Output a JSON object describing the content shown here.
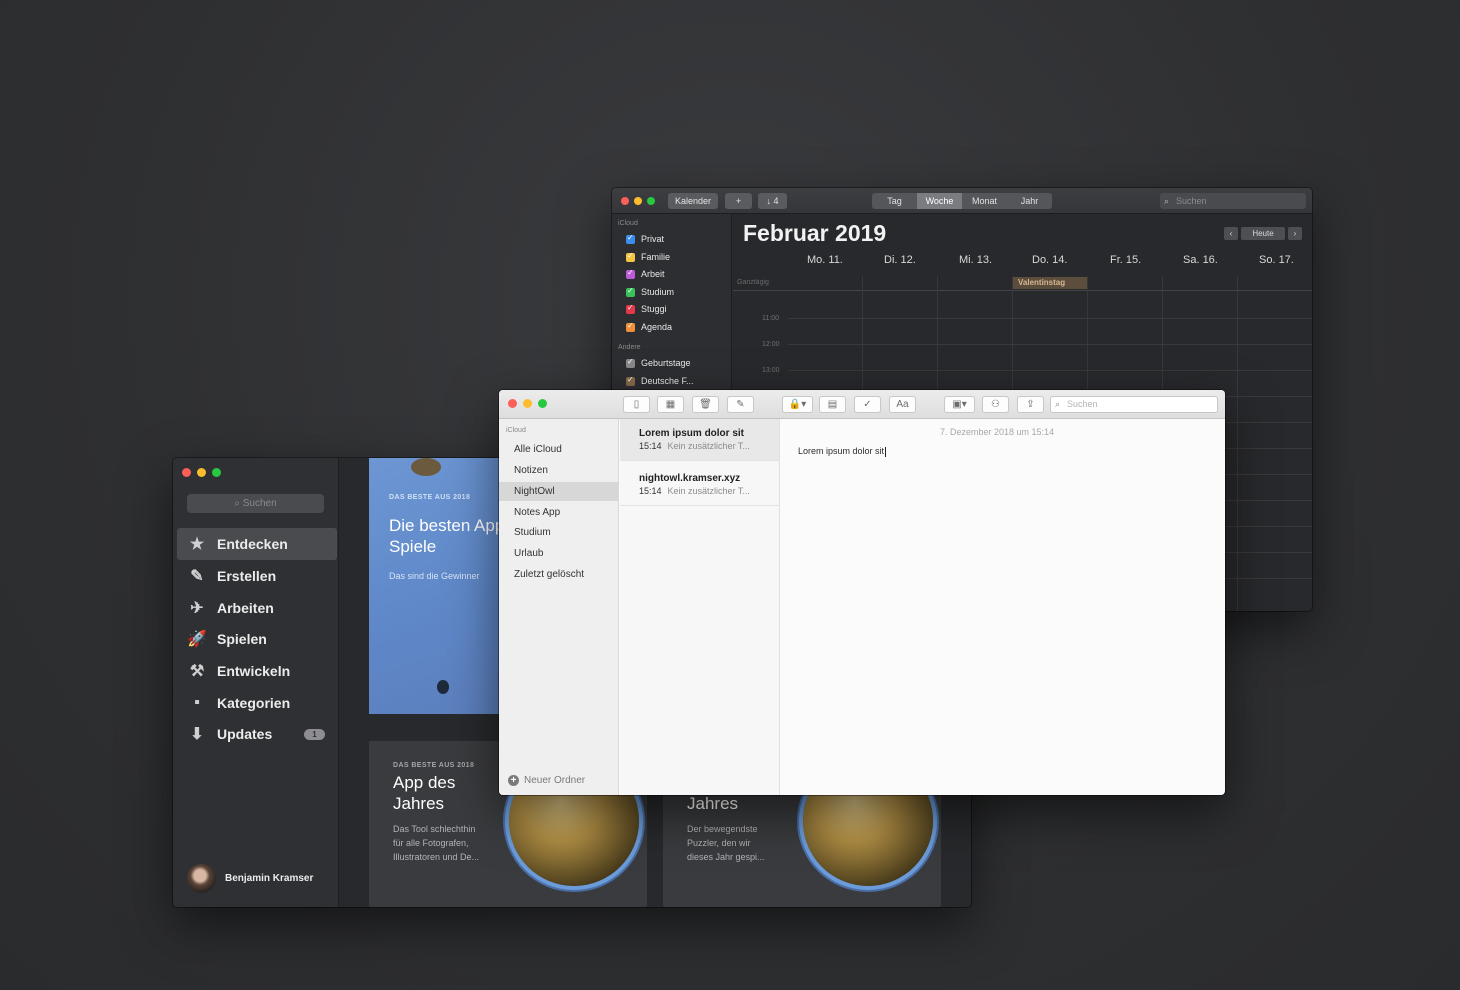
{
  "calendar": {
    "toolbar": {
      "calendars_button": "Kalender",
      "add_button": "+",
      "inbox_button": "↓ 4",
      "views": [
        "Tag",
        "Woche",
        "Monat",
        "Jahr"
      ],
      "active_view": "Woche",
      "search_placeholder": "Suchen"
    },
    "sidebar": {
      "section_icloud": "iCloud",
      "icloud_items": [
        {
          "label": "Privat",
          "color": "#3b8ef0"
        },
        {
          "label": "Familie",
          "color": "#f6c443"
        },
        {
          "label": "Arbeit",
          "color": "#bb5bd8"
        },
        {
          "label": "Studium",
          "color": "#39c15a"
        },
        {
          "label": "Stuggi",
          "color": "#e3394a"
        },
        {
          "label": "Agenda",
          "color": "#f0903a"
        }
      ],
      "section_other": "Andere",
      "other_items": [
        {
          "label": "Geburtstage",
          "color": "#8a8a8c"
        },
        {
          "label": "Deutsche F...",
          "color": "#8a6a4a"
        }
      ]
    },
    "title": "Februar 2019",
    "today_button": "Heute",
    "prev_icon": "‹",
    "next_icon": "›",
    "days": [
      "Mo. 11.",
      "Di. 12.",
      "Mi. 13.",
      "Do. 14.",
      "Fr. 15.",
      "Sa. 16.",
      "So. 17."
    ],
    "allday_label": "Ganztägig",
    "allday_event": "Valentinstag",
    "times": [
      "11:00",
      "12:00",
      "13:00"
    ]
  },
  "appstore": {
    "search_placeholder": "Suchen",
    "nav": [
      {
        "label": "Entdecken",
        "icon": "★"
      },
      {
        "label": "Erstellen",
        "icon": "✎"
      },
      {
        "label": "Arbeiten",
        "icon": "✈"
      },
      {
        "label": "Spielen",
        "icon": "🚀"
      },
      {
        "label": "Entwickeln",
        "icon": "⚒"
      },
      {
        "label": "Kategorien",
        "icon": "▪"
      },
      {
        "label": "Updates",
        "icon": "⬇"
      }
    ],
    "updates_badge": "1",
    "user_name": "Benjamin Kramser",
    "card1": {
      "eyebrow": "DAS BESTE AUS 2018",
      "title": "Die besten Apps und Spiele",
      "subtitle": "Das sind die Gewinner"
    },
    "card2": {
      "eyebrow": "DAS BESTE AUS 2018",
      "title_line1": "App des",
      "title_line2": "Jahres",
      "desc_line1": "Das Tool schlechthin",
      "desc_line2": "für alle Fotografen,",
      "desc_line3": "Illustratoren und De..."
    },
    "card3": {
      "title_line2": "Jahres",
      "desc_line1": "Der bewegendste",
      "desc_line2": "Puzzler, den wir",
      "desc_line3": "dieses Jahr gespi..."
    }
  },
  "notes": {
    "search_placeholder": "Suchen",
    "section": "iCloud",
    "folders": [
      "Alle iCloud",
      "Notizen",
      "NightOwl",
      "Notes App",
      "Studium",
      "Urlaub",
      "Zuletzt gelöscht"
    ],
    "active_folder": "NightOwl",
    "new_folder": "Neuer Ordner",
    "notes_list": [
      {
        "title": "Lorem ipsum dolor sit",
        "time": "15:14",
        "preview": "Kein zusätzlicher T..."
      },
      {
        "title": "nightowl.kramser.xyz",
        "time": "15:14",
        "preview": "Kein zusätzlicher T..."
      }
    ],
    "editor_date": "7. Dezember 2018 um 15:14",
    "editor_text": "Lorem ipsum dolor sit"
  }
}
